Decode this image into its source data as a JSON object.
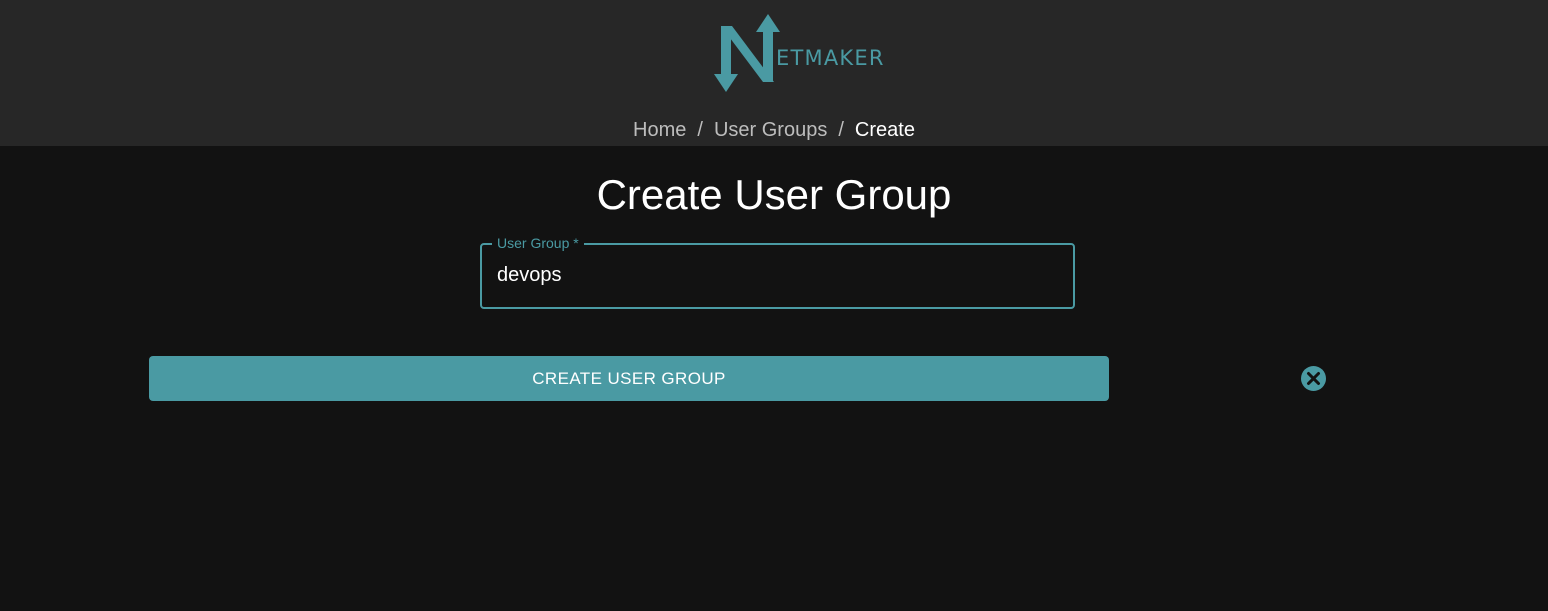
{
  "header": {
    "logo_text": "ETMAKER"
  },
  "breadcrumb": {
    "items": [
      "Home",
      "User Groups",
      "Create"
    ],
    "separator": "/"
  },
  "page": {
    "title": "Create User Group"
  },
  "form": {
    "user_group": {
      "label": "User Group *",
      "value": "devops"
    },
    "submit_label": "CREATE USER GROUP"
  },
  "icons": {
    "cancel": "close-circle-icon",
    "logo": "netmaker-logo-icon"
  },
  "colors": {
    "accent": "#4a9aa3",
    "header_bg": "#272727",
    "page_bg": "#121212"
  }
}
